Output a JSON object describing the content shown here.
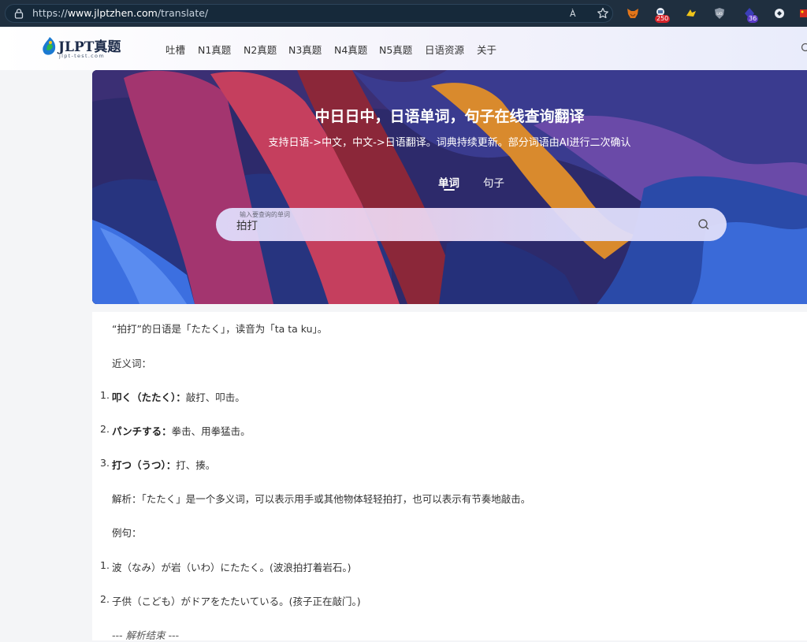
{
  "browser": {
    "url_prefix": "https://",
    "url_host": "www.jlptzhen.com",
    "url_path": "/translate/",
    "read_aloud": "À",
    "extensions": [
      {
        "name": "metamask-icon"
      },
      {
        "name": "extension-icon",
        "badge": "250"
      },
      {
        "name": "extension-icon"
      },
      {
        "name": "ublock-icon"
      },
      {
        "name": "extension-icon",
        "badge": "36"
      },
      {
        "name": "extension-icon"
      },
      {
        "name": "flag-icon"
      }
    ],
    "colors": {
      "bar": "#1f2f3f",
      "badge_red": "#d6232a",
      "badge_purple": "#5b3ac8"
    }
  },
  "header": {
    "logo_title": "JLPT真题",
    "logo_subtitle": "jlpt-test.com",
    "nav": [
      "吐槽",
      "N1真题",
      "N2真题",
      "N3真题",
      "N4真题",
      "N5真题",
      "日语资源",
      "关于"
    ]
  },
  "hero": {
    "title": "中日日中，日语单词，句子在线查询翻译",
    "subtitle": "支持日语->中文，中文->日语翻译。词典持续更新。部分词语由AI进行二次确认",
    "tabs": [
      "单词",
      "句子"
    ],
    "active_tab": "单词",
    "search": {
      "label": "输入要查询的单词",
      "value": "拍打"
    }
  },
  "result": {
    "intro": "“拍打”的日语是「たたく」，读音为「ta ta ku」。",
    "synonyms_heading": "近义词：",
    "synonyms": [
      {
        "n": "1.",
        "term": "叩く（たたく）",
        "sep": "：",
        "meaning": "敲打、叩击。"
      },
      {
        "n": "2.",
        "term": "パンチする",
        "sep": "：",
        "meaning": "拳击、用拳猛击。"
      },
      {
        "n": "3.",
        "term": "打つ（うつ）",
        "sep": "：",
        "meaning": "打、揍。"
      }
    ],
    "analysis": "解析：「たたく」是一个多义词，可以表示用手或其他物体轻轻拍打，也可以表示有节奏地敲击。",
    "examples_heading": "例句：",
    "examples": [
      {
        "n": "1.",
        "text": "波（なみ）が岩（いわ）にたたく。(波浪拍打着岩石。)"
      },
      {
        "n": "2.",
        "text": "子供（こども）がドアをたたいている。(孩子正在敲门。)"
      }
    ],
    "end_marker": "--- 解析结束 ---"
  }
}
